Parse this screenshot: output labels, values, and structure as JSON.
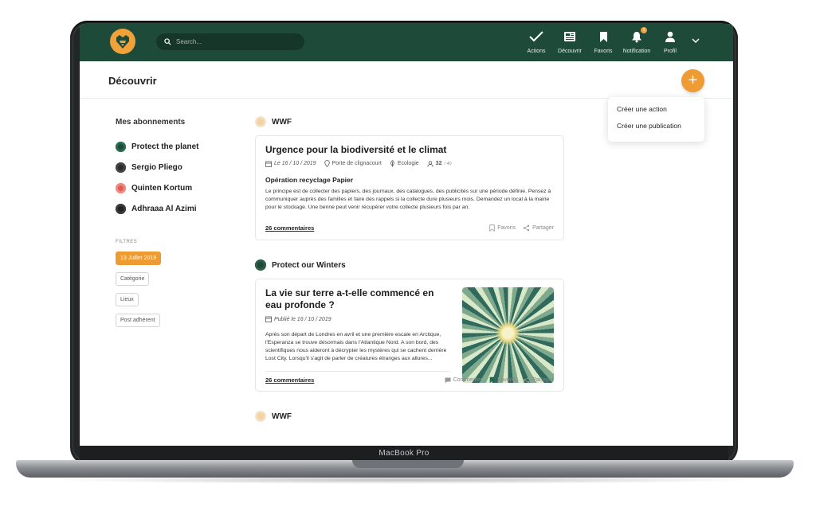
{
  "device": {
    "label": "MacBook Pro"
  },
  "topbar": {
    "search_placeholder": "Search...",
    "nav": [
      {
        "label": "Actions",
        "icon": "check-icon"
      },
      {
        "label": "Découvrir",
        "icon": "newspaper-icon"
      },
      {
        "label": "Favoris",
        "icon": "bookmark-icon"
      },
      {
        "label": "Notification",
        "icon": "bell-icon",
        "badge": "1"
      },
      {
        "label": "Profil",
        "icon": "user-icon"
      }
    ]
  },
  "page": {
    "title": "Découvrir",
    "add_label": "+"
  },
  "dropdown": {
    "items": [
      "Créer une action",
      "Créer une publication"
    ]
  },
  "sidebar": {
    "title": "Mes abonnements",
    "subscriptions": [
      {
        "name": "Protect the planet",
        "color": "#1f4a39"
      },
      {
        "name": "Sergio Pliego",
        "color": "#2b2b2b"
      },
      {
        "name": "Quinten Kortum",
        "color": "#e25b55"
      },
      {
        "name": "Adhraaa Al Azimi",
        "color": "#222222"
      }
    ],
    "filters_title": "FILTRES",
    "filters": [
      {
        "label": "13 Juillet 2019",
        "active": true
      },
      {
        "label": "Catégorie",
        "active": false
      },
      {
        "label": "Lieux",
        "active": false
      },
      {
        "label": "Post adhérent",
        "active": false
      }
    ]
  },
  "feed": {
    "post1": {
      "author": "WWF",
      "title": "Urgence pour la biodiversité et le climat",
      "date": "Le 16 / 10 / 2019",
      "place": "Porte de clignacourt",
      "category": "Ecologie",
      "participants": "32",
      "participants_max": "/ 40",
      "subtitle": "Opération recyclage Papier",
      "body": "Le principe est de collecter des papiers, des journaux, des catalogues, des publicités sur une période définie. Pensez à communiquer auprès des familles et faire des rappels si la collecte dure plusieurs mois. Demandez un local à la mairie pour le stockage. Une benne peut venir récupérer votre collecte plusieurs fois par an.",
      "comments": "26 commentaires",
      "favoris": "Favoris",
      "share": "Partager"
    },
    "post2": {
      "author": "Protect our Winters",
      "title": "La vie sur terre a-t-elle commencé en eau profonde ?",
      "date": "Publié le 16 / 10 / 2019",
      "body": "Après son départ de Londres en avril et une première escale en Arctique, l'Esperanza se trouve désormais dans l'Atlantique Nord. A son bord, des scientifiques nous aideront à décrypter les mystères qui se cachent derrière Lost City. Lorsqu'il s'agit de parler de créatures étranges aux allures...",
      "comments": "26 commentaires",
      "comment_action": "Commenter",
      "favoris": "Favoris",
      "share": "Partager"
    },
    "post3": {
      "author": "WWF"
    }
  },
  "colors": {
    "topbar": "#1e4a39",
    "accent": "#ee9b34"
  }
}
